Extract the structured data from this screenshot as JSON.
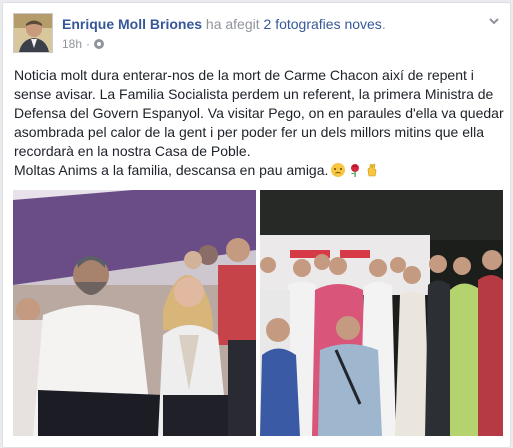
{
  "post": {
    "author": "Enrique Moll Briones",
    "action_prefix": "ha afegit",
    "action_link": "2 fotografies noves",
    "action_suffix": ".",
    "timestamp": "18h",
    "privacy_icon": "globe-icon",
    "options_icon": "chevron-down-icon",
    "text_paragraph_1": "Noticia molt dura enterar-nos de la mort de Carme Chacon així de repent i sense avisar. La Familia Socialista perdem un referent, la primera Ministra de Defensa del Govern Espanyol. Va visitar Pego, on en paraules d'ella va quedar asombrada pel calor de la gent i per poder fer un dels millors mitins que ella recordarà en la nostra Casa de Poble.",
    "text_paragraph_2": "Moltas Anims a la familia, descansa en pau amiga.",
    "emojis": [
      "disappointed-face-icon",
      "rose-icon",
      "crossed-fingers-icon"
    ]
  },
  "colors": {
    "link": "#365899",
    "text": "#1d2129",
    "meta": "#90949c"
  }
}
